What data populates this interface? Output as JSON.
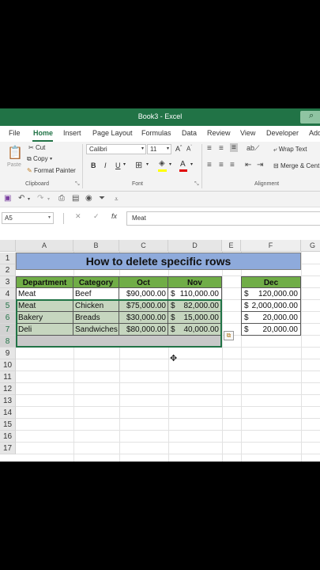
{
  "window": {
    "title": "Book3  -  Excel"
  },
  "tabs": [
    "File",
    "Home",
    "Insert",
    "Page Layout",
    "Formulas",
    "Data",
    "Review",
    "View",
    "Developer",
    "Add"
  ],
  "ribbon": {
    "paste": "Paste",
    "cut": "Cut",
    "copy": "Copy",
    "format_painter": "Format Painter",
    "clipboard_group": "Clipboard",
    "font_name": "Calibri",
    "font_size": "11",
    "font_group": "Font",
    "wrap_text": "Wrap Text",
    "merge_center": "Merge & Cent",
    "alignment_group": "Alignment",
    "bold": "B",
    "italic": "I",
    "underline": "U",
    "grow_font": "A^",
    "shrink_font": "Aˇ"
  },
  "formula_bar": {
    "name_box": "A5",
    "content": "Meat",
    "fx": "fx"
  },
  "columns": [
    "A",
    "B",
    "C",
    "D",
    "E",
    "F",
    "G"
  ],
  "rows": [
    "1",
    "2",
    "3",
    "4",
    "5",
    "6",
    "7",
    "8",
    "9",
    "10",
    "11",
    "12",
    "13",
    "14",
    "15",
    "16",
    "17"
  ],
  "sheet": {
    "title": "How to delete specific rows",
    "headers": [
      "Department",
      "Category",
      "Oct",
      "Nov"
    ],
    "dec_header": "Dec",
    "data": [
      {
        "dept": "Meat",
        "cat": "Beef",
        "oct": "$90,000.00",
        "nov_cur": "$",
        "nov": "110,000.00",
        "dec_cur": "$",
        "dec": "120,000.00"
      },
      {
        "dept": "Meat",
        "cat": "Chicken",
        "oct": "$75,000.00",
        "nov_cur": "$",
        "nov": "82,000.00",
        "dec_cur": "$",
        "dec": "2,000,000.00"
      },
      {
        "dept": "Bakery",
        "cat": "Breads",
        "oct": "$30,000.00",
        "nov_cur": "$",
        "nov": "15,000.00",
        "dec_cur": "$",
        "dec": "20,000.00"
      },
      {
        "dept": "Deli",
        "cat": "Sandwiches",
        "oct": "$80,000.00",
        "nov_cur": "$",
        "nov": "40,000.00",
        "dec_cur": "$",
        "dec": "20,000.00"
      }
    ]
  },
  "colors": {
    "excel_green": "#217346",
    "header_green": "#70ad47",
    "title_blue": "#8eaadb",
    "selection": "#c6d6bf"
  }
}
